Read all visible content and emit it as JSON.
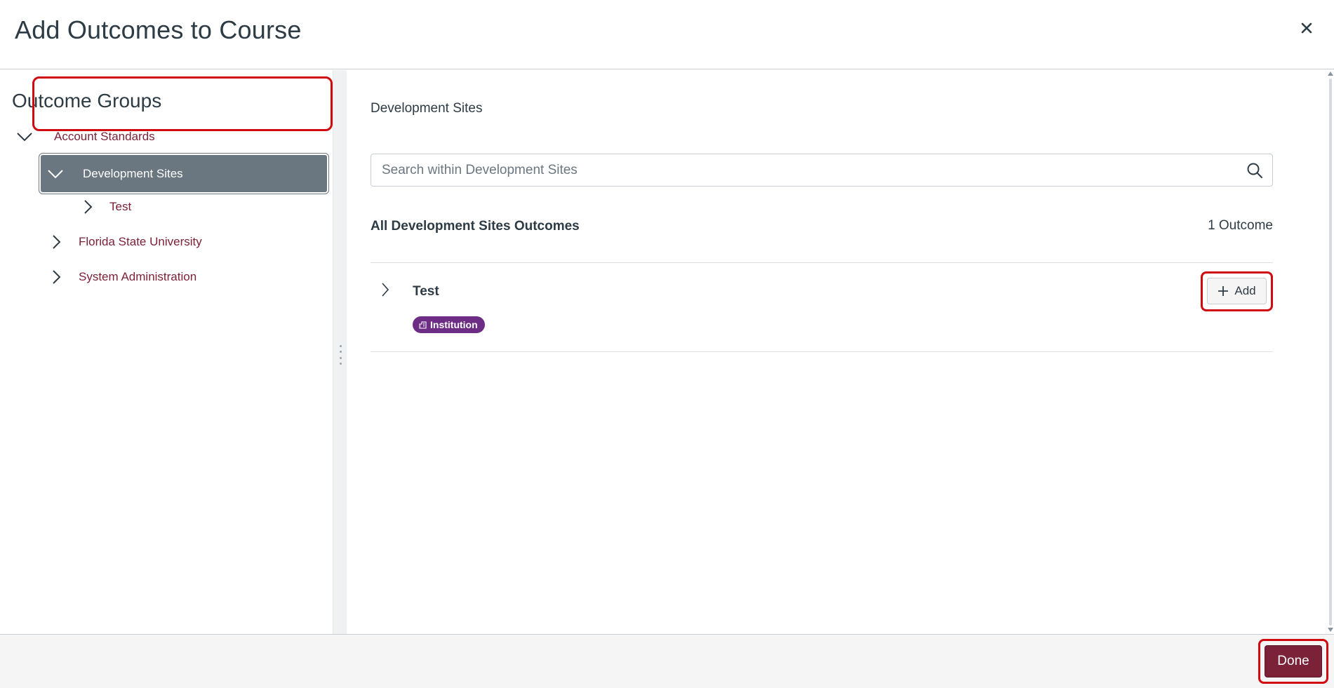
{
  "modal": {
    "title": "Add Outcomes to Course",
    "close_label": "×"
  },
  "sidebar": {
    "title": "Outcome Groups",
    "items": [
      {
        "label": "Account Standards",
        "state": "expanded"
      },
      {
        "label": "Development Sites",
        "state": "expanded",
        "selected": true
      },
      {
        "label": "Test",
        "state": "collapsed"
      },
      {
        "label": "Florida State University",
        "state": "collapsed"
      },
      {
        "label": "System Administration",
        "state": "collapsed"
      }
    ]
  },
  "main": {
    "breadcrumb": "Development Sites",
    "search": {
      "placeholder": "Search within Development Sites",
      "value": ""
    },
    "section_title": "All Development Sites Outcomes",
    "count": "1 Outcome",
    "outcomes": [
      {
        "name": "Test",
        "badge": "Institution",
        "add_label": "Add"
      }
    ]
  },
  "footer": {
    "done_label": "Done"
  },
  "colors": {
    "brand": "#7b2138",
    "selected_bg": "#6b7780",
    "badge_bg": "#6d2d84",
    "highlight": "#d10a10"
  }
}
